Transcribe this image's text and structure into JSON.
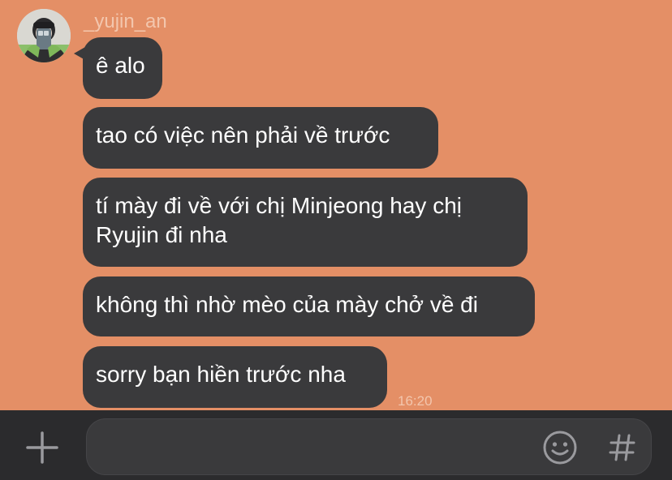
{
  "conversation": {
    "sender_name": "_yujin_an",
    "avatar_icon": "profile-photo",
    "messages": [
      {
        "text": "ê alo"
      },
      {
        "text": "tao có việc nên phải về trước"
      },
      {
        "text": "tí mày đi về với chị Minjeong hay chị Ryujin đi nha"
      },
      {
        "text": "không thì nhờ mèo của mày chở về đi"
      },
      {
        "text": "sorry bạn hiền trước nha"
      }
    ],
    "timestamp": "16:20"
  },
  "input_bar": {
    "message_value": "",
    "plus_icon": "plus-icon",
    "emoji_icon": "smiley-icon",
    "hashtag_icon": "hashtag-icon"
  },
  "colors": {
    "chat_background": "#e48f66",
    "bubble": "#3a3a3c",
    "bubble_text": "#ffffff",
    "meta_text": "#f3c6ad",
    "input_bar": "#2b2b2d"
  }
}
